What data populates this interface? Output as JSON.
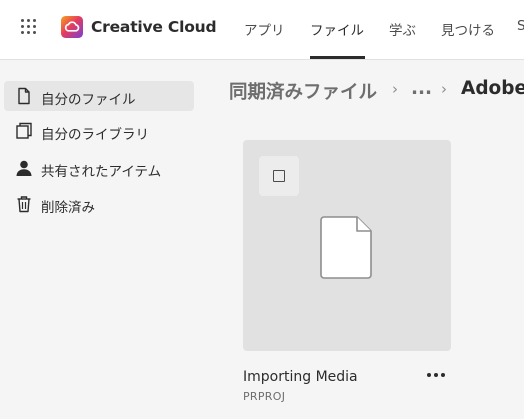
{
  "header": {
    "brand": "Creative Cloud",
    "tabs": [
      {
        "label": "アプリ",
        "active": false
      },
      {
        "label": "ファイル",
        "active": true
      },
      {
        "label": "学ぶ",
        "active": false
      },
      {
        "label": "見つける",
        "active": false
      }
    ],
    "search_fragment": "S"
  },
  "sidebar": {
    "items": [
      {
        "label": "自分のファイル",
        "icon": "file-icon",
        "active": true
      },
      {
        "label": "自分のライブラリ",
        "icon": "library-icon",
        "active": false
      },
      {
        "label": "共有されたアイテム",
        "icon": "person-icon",
        "active": false
      },
      {
        "label": "削除済み",
        "icon": "trash-icon",
        "active": false
      }
    ]
  },
  "breadcrumb": {
    "items": [
      "同期済みファイル",
      "...",
      "Adobe"
    ],
    "separator": "›"
  },
  "files": [
    {
      "name": "Importing Media",
      "type": "PRPROJ"
    }
  ],
  "colors": {
    "accent": "#2c2c2c",
    "background": "#f5f5f5",
    "card": "#e1e1e1"
  }
}
